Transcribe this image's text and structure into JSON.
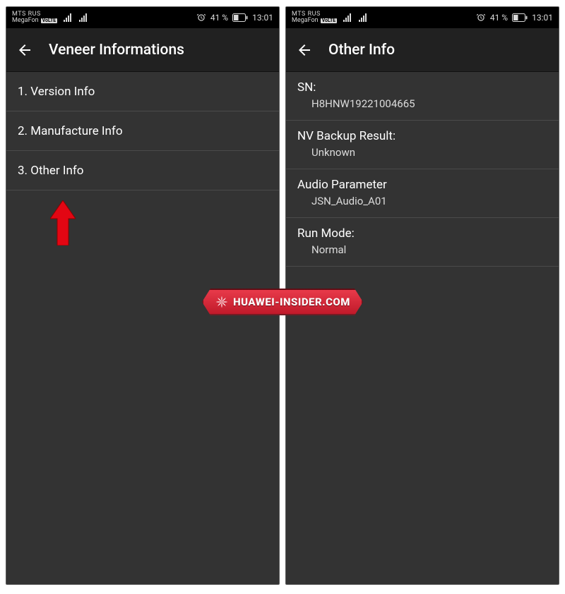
{
  "status": {
    "carrier1": "MTS RUS",
    "carrier2": "MegaFon",
    "volte": "VoLTE",
    "alarm_icon": "alarm",
    "battery_text": "41 %",
    "time": "13:01"
  },
  "left": {
    "title": "Veneer Informations",
    "items": [
      "1. Version Info",
      "2. Manufacture Info",
      "3. Other Info"
    ]
  },
  "right": {
    "title": "Other Info",
    "items": [
      {
        "label": "SN:",
        "value": "H8HNW19221004665"
      },
      {
        "label": "NV Backup Result:",
        "value": "Unknown"
      },
      {
        "label": "Audio Parameter",
        "value": "JSN_Audio_A01"
      },
      {
        "label": "Run Mode:",
        "value": "Normal"
      }
    ]
  },
  "watermark": {
    "text": "HUAWEI-INSIDER.COM"
  }
}
